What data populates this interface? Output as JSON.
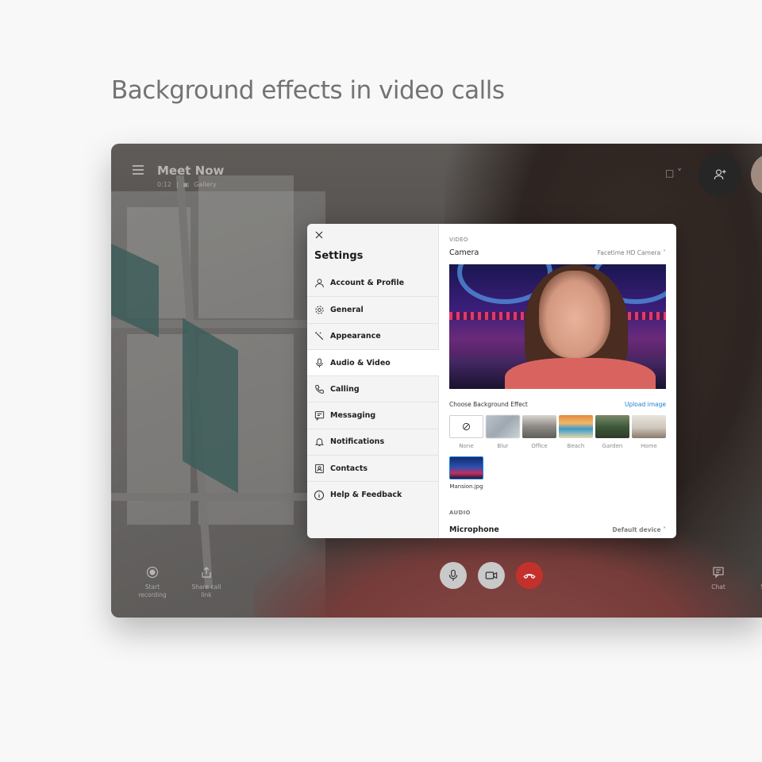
{
  "headline": "Background effects in video calls",
  "call": {
    "title": "Meet Now",
    "duration": "0:12",
    "view": "Gallery"
  },
  "bottom_left": [
    {
      "label": "Start recording",
      "icon": "record-icon"
    },
    {
      "label": "Share call link",
      "icon": "share-icon"
    }
  ],
  "bottom_right": [
    {
      "label": "Chat",
      "icon": "chat-icon"
    },
    {
      "label": "Screen share",
      "icon": "screen-share-icon"
    }
  ],
  "settings": {
    "title": "Settings",
    "nav": [
      {
        "label": "Account & Profile",
        "icon": "person-icon"
      },
      {
        "label": "General",
        "icon": "gear-icon"
      },
      {
        "label": "Appearance",
        "icon": "wand-icon"
      },
      {
        "label": "Audio & Video",
        "icon": "microphone-icon",
        "active": true
      },
      {
        "label": "Calling",
        "icon": "phone-icon"
      },
      {
        "label": "Messaging",
        "icon": "message-icon"
      },
      {
        "label": "Notifications",
        "icon": "bell-icon"
      },
      {
        "label": "Contacts",
        "icon": "contacts-icon"
      },
      {
        "label": "Help & Feedback",
        "icon": "info-icon"
      }
    ],
    "video_section": "VIDEO",
    "camera_label": "Camera",
    "camera_value": "Facetime HD Camera",
    "choose_label": "Choose Background Effect",
    "upload_link": "Upload image",
    "effects": [
      "None",
      "Blur",
      "Office",
      "Beach",
      "Garden",
      "Home"
    ],
    "custom_effect": "Mansion.jpg",
    "audio_section": "AUDIO",
    "mic_label": "Microphone",
    "mic_value": "Default device"
  },
  "colors": {
    "accent": "#1a7fd4",
    "end_call": "#c4312d"
  }
}
